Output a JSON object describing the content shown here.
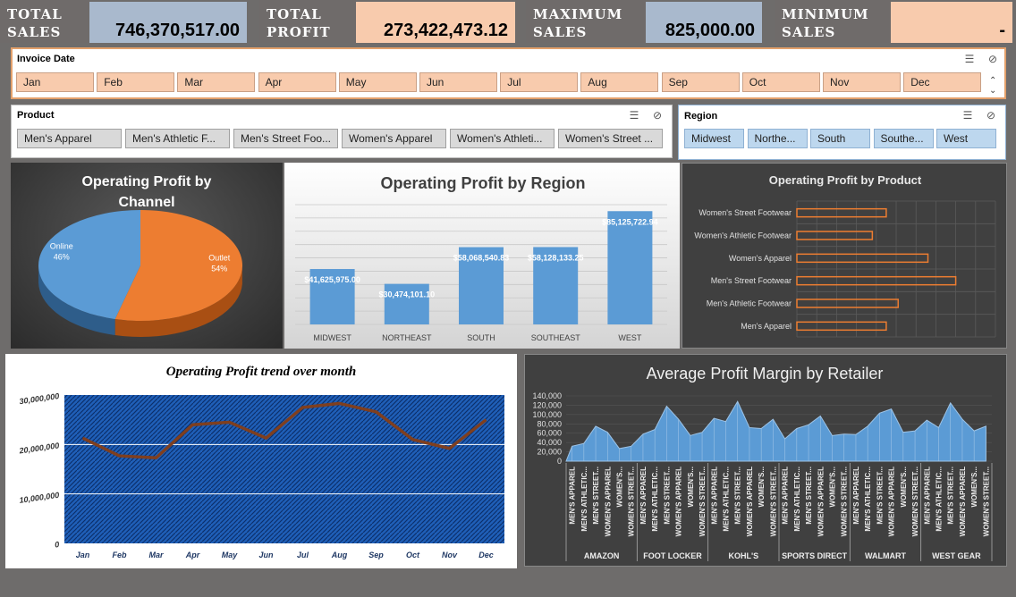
{
  "kpis": {
    "total_sales_label": "TOTAL SALES",
    "total_sales_value": "746,370,517.00",
    "total_profit_label": "TOTAL PROFIT",
    "total_profit_value": "273,422,473.12",
    "max_sales_label": "MAXIMUM SALES",
    "max_sales_value": "825,000.00",
    "min_sales_label": "MINIMUM SALES",
    "min_sales_value": "-"
  },
  "invoice_slicer": {
    "title": "Invoice Date",
    "items": [
      "Jan",
      "Feb",
      "Mar",
      "Apr",
      "May",
      "Jun",
      "Jul",
      "Aug",
      "Sep",
      "Oct",
      "Nov",
      "Dec"
    ]
  },
  "product_slicer": {
    "title": "Product",
    "items": [
      "Men's Apparel",
      "Men's Athletic F...",
      "Men's Street Foo...",
      "Women's Apparel",
      "Women's Athleti...",
      "Women's Street ..."
    ]
  },
  "region_slicer": {
    "title": "Region",
    "items": [
      "Midwest",
      "Northe...",
      "South",
      "Southe...",
      "West"
    ]
  },
  "chart_data": [
    {
      "type": "pie",
      "title": "Operating Profit by Channel",
      "slices": [
        {
          "name": "Outlet",
          "percent": 54,
          "label": "54%",
          "color": "#ed7d31"
        },
        {
          "name": "Online",
          "percent": 46,
          "label": "46%",
          "color": "#5b9bd5"
        }
      ]
    },
    {
      "type": "bar",
      "title": "Operating Profit by Region",
      "categories": [
        "MIDWEST",
        "NORTHEAST",
        "SOUTH",
        "SOUTHEAST",
        "WEST"
      ],
      "values": [
        41625975,
        30474101.1,
        58068540.83,
        58128133.25,
        85125722.94
      ],
      "data_labels": [
        "$41,625,975.00",
        "$30,474,101.10",
        "$58,068,540.83",
        "$58,128,133.25",
        "$85,125,722.94"
      ],
      "color": "#5b9bd5"
    },
    {
      "type": "bar",
      "orientation": "horizontal",
      "title": "Operating Profit by Product",
      "categories": [
        "Women's Street Footwear",
        "Women's Athletic Footwear",
        "Women's Apparel",
        "Men's Street Footwear",
        "Men's Athletic Footwear",
        "Men's Apparel"
      ],
      "values": [
        45,
        38,
        66,
        80,
        51,
        45
      ],
      "color": "#ed7d31"
    },
    {
      "type": "line",
      "title": "Operating Profit trend over month",
      "categories": [
        "Jan",
        "Feb",
        "Mar",
        "Apr",
        "May",
        "Jun",
        "Jul",
        "Aug",
        "Sep",
        "Oct",
        "Nov",
        "Dec"
      ],
      "values": [
        21300000,
        17700000,
        17300000,
        24000000,
        24500000,
        21300000,
        27500000,
        28300000,
        26600000,
        21000000,
        19200000,
        25000000
      ],
      "yticks": [
        "0",
        "10,000,000",
        "20,000,000",
        "30,000,000"
      ],
      "ylim": [
        0,
        30000000
      ],
      "color": "#7f3f1f"
    },
    {
      "type": "area",
      "title": "Average Profit Margin by Retailer",
      "yticks": [
        "0",
        "20,000",
        "40,000",
        "60,000",
        "80,000",
        "100,000",
        "120,000",
        "140,000"
      ],
      "ylim": [
        0,
        140000
      ],
      "retailers": [
        "AMAZON",
        "FOOT LOCKER",
        "KOHL'S",
        "SPORTS DIRECT",
        "WALMART",
        "WEST GEAR"
      ],
      "x_labels": [
        "MEN'S APPAREL",
        "MEN'S ATHLETIC...",
        "MEN'S STREET...",
        "WOMEN'S APPAREL",
        "WOMEN'S...",
        "WOMEN'S STREET..."
      ],
      "values": [
        32000,
        38000,
        75000,
        62000,
        27000,
        32000,
        58000,
        68000,
        118000,
        90000,
        55000,
        62000,
        92000,
        85000,
        128000,
        72000,
        70000,
        90000,
        48000,
        70000,
        78000,
        97000,
        55000,
        58000,
        57000,
        75000,
        103000,
        112000,
        62000,
        65000,
        88000,
        72000,
        125000,
        90000,
        65000,
        75000
      ],
      "color": "#5b9bd5"
    }
  ]
}
